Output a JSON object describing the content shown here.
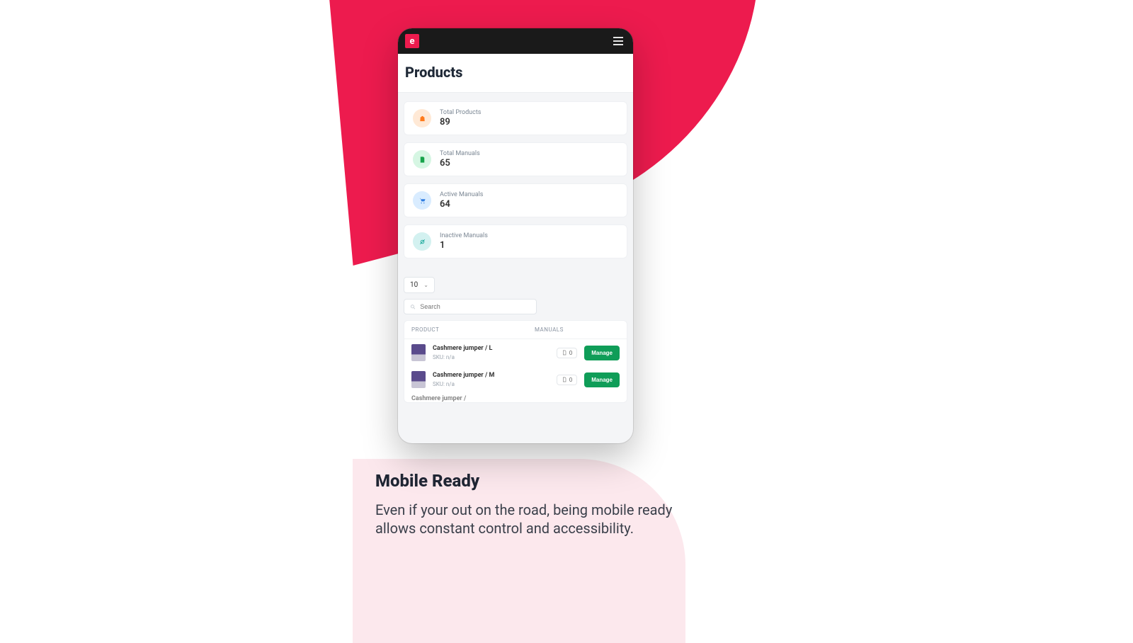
{
  "logo_letter": "e",
  "page_title": "Products",
  "stats": [
    {
      "label": "Total Products",
      "value": "89"
    },
    {
      "label": "Total Manuals",
      "value": "65"
    },
    {
      "label": "Active Manuals",
      "value": "64"
    },
    {
      "label": "Inactive Manuals",
      "value": "1"
    }
  ],
  "per_page": "10",
  "search_placeholder": "Search",
  "table": {
    "head_product": "PRODUCT",
    "head_manuals": "MANUALS",
    "manage_label": "Manage",
    "sku_prefix": "SKU: ",
    "rows": [
      {
        "name": "Cashmere jumper / L",
        "sku": "n/a",
        "manuals": "0"
      },
      {
        "name": "Cashmere jumper / M",
        "sku": "n/a",
        "manuals": "0"
      }
    ],
    "cut_row_name": "Cashmere jumper /"
  },
  "marketing": {
    "title": "Mobile Ready",
    "body": "Even if your out on the road, being mobile ready allows constant control and accessibility."
  }
}
